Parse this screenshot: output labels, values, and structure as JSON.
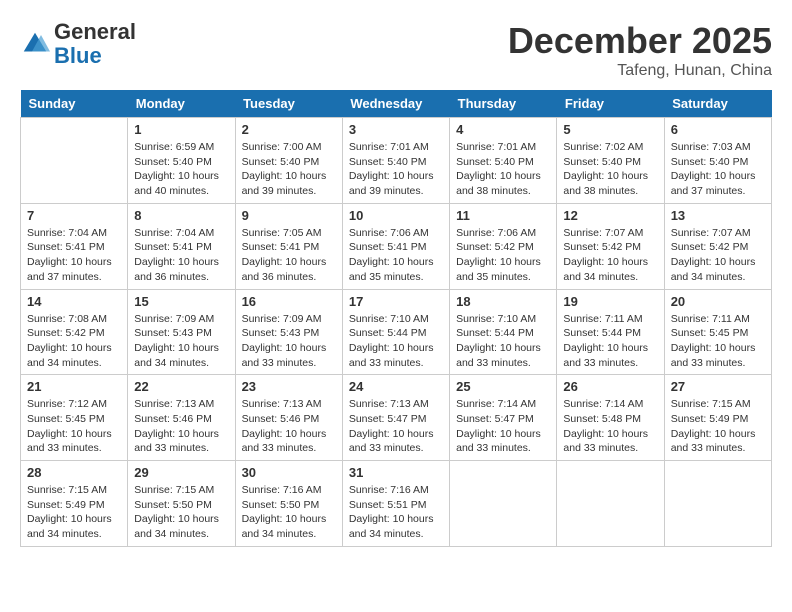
{
  "header": {
    "logo_line1": "General",
    "logo_line2": "Blue",
    "month": "December 2025",
    "location": "Tafeng, Hunan, China"
  },
  "weekdays": [
    "Sunday",
    "Monday",
    "Tuesday",
    "Wednesday",
    "Thursday",
    "Friday",
    "Saturday"
  ],
  "weeks": [
    [
      {
        "day": "",
        "info": ""
      },
      {
        "day": "1",
        "info": "Sunrise: 6:59 AM\nSunset: 5:40 PM\nDaylight: 10 hours\nand 40 minutes."
      },
      {
        "day": "2",
        "info": "Sunrise: 7:00 AM\nSunset: 5:40 PM\nDaylight: 10 hours\nand 39 minutes."
      },
      {
        "day": "3",
        "info": "Sunrise: 7:01 AM\nSunset: 5:40 PM\nDaylight: 10 hours\nand 39 minutes."
      },
      {
        "day": "4",
        "info": "Sunrise: 7:01 AM\nSunset: 5:40 PM\nDaylight: 10 hours\nand 38 minutes."
      },
      {
        "day": "5",
        "info": "Sunrise: 7:02 AM\nSunset: 5:40 PM\nDaylight: 10 hours\nand 38 minutes."
      },
      {
        "day": "6",
        "info": "Sunrise: 7:03 AM\nSunset: 5:40 PM\nDaylight: 10 hours\nand 37 minutes."
      }
    ],
    [
      {
        "day": "7",
        "info": "Sunrise: 7:04 AM\nSunset: 5:41 PM\nDaylight: 10 hours\nand 37 minutes."
      },
      {
        "day": "8",
        "info": "Sunrise: 7:04 AM\nSunset: 5:41 PM\nDaylight: 10 hours\nand 36 minutes."
      },
      {
        "day": "9",
        "info": "Sunrise: 7:05 AM\nSunset: 5:41 PM\nDaylight: 10 hours\nand 36 minutes."
      },
      {
        "day": "10",
        "info": "Sunrise: 7:06 AM\nSunset: 5:41 PM\nDaylight: 10 hours\nand 35 minutes."
      },
      {
        "day": "11",
        "info": "Sunrise: 7:06 AM\nSunset: 5:42 PM\nDaylight: 10 hours\nand 35 minutes."
      },
      {
        "day": "12",
        "info": "Sunrise: 7:07 AM\nSunset: 5:42 PM\nDaylight: 10 hours\nand 34 minutes."
      },
      {
        "day": "13",
        "info": "Sunrise: 7:07 AM\nSunset: 5:42 PM\nDaylight: 10 hours\nand 34 minutes."
      }
    ],
    [
      {
        "day": "14",
        "info": "Sunrise: 7:08 AM\nSunset: 5:42 PM\nDaylight: 10 hours\nand 34 minutes."
      },
      {
        "day": "15",
        "info": "Sunrise: 7:09 AM\nSunset: 5:43 PM\nDaylight: 10 hours\nand 34 minutes."
      },
      {
        "day": "16",
        "info": "Sunrise: 7:09 AM\nSunset: 5:43 PM\nDaylight: 10 hours\nand 33 minutes."
      },
      {
        "day": "17",
        "info": "Sunrise: 7:10 AM\nSunset: 5:44 PM\nDaylight: 10 hours\nand 33 minutes."
      },
      {
        "day": "18",
        "info": "Sunrise: 7:10 AM\nSunset: 5:44 PM\nDaylight: 10 hours\nand 33 minutes."
      },
      {
        "day": "19",
        "info": "Sunrise: 7:11 AM\nSunset: 5:44 PM\nDaylight: 10 hours\nand 33 minutes."
      },
      {
        "day": "20",
        "info": "Sunrise: 7:11 AM\nSunset: 5:45 PM\nDaylight: 10 hours\nand 33 minutes."
      }
    ],
    [
      {
        "day": "21",
        "info": "Sunrise: 7:12 AM\nSunset: 5:45 PM\nDaylight: 10 hours\nand 33 minutes."
      },
      {
        "day": "22",
        "info": "Sunrise: 7:13 AM\nSunset: 5:46 PM\nDaylight: 10 hours\nand 33 minutes."
      },
      {
        "day": "23",
        "info": "Sunrise: 7:13 AM\nSunset: 5:46 PM\nDaylight: 10 hours\nand 33 minutes."
      },
      {
        "day": "24",
        "info": "Sunrise: 7:13 AM\nSunset: 5:47 PM\nDaylight: 10 hours\nand 33 minutes."
      },
      {
        "day": "25",
        "info": "Sunrise: 7:14 AM\nSunset: 5:47 PM\nDaylight: 10 hours\nand 33 minutes."
      },
      {
        "day": "26",
        "info": "Sunrise: 7:14 AM\nSunset: 5:48 PM\nDaylight: 10 hours\nand 33 minutes."
      },
      {
        "day": "27",
        "info": "Sunrise: 7:15 AM\nSunset: 5:49 PM\nDaylight: 10 hours\nand 33 minutes."
      }
    ],
    [
      {
        "day": "28",
        "info": "Sunrise: 7:15 AM\nSunset: 5:49 PM\nDaylight: 10 hours\nand 34 minutes."
      },
      {
        "day": "29",
        "info": "Sunrise: 7:15 AM\nSunset: 5:50 PM\nDaylight: 10 hours\nand 34 minutes."
      },
      {
        "day": "30",
        "info": "Sunrise: 7:16 AM\nSunset: 5:50 PM\nDaylight: 10 hours\nand 34 minutes."
      },
      {
        "day": "31",
        "info": "Sunrise: 7:16 AM\nSunset: 5:51 PM\nDaylight: 10 hours\nand 34 minutes."
      },
      {
        "day": "",
        "info": ""
      },
      {
        "day": "",
        "info": ""
      },
      {
        "day": "",
        "info": ""
      }
    ]
  ]
}
